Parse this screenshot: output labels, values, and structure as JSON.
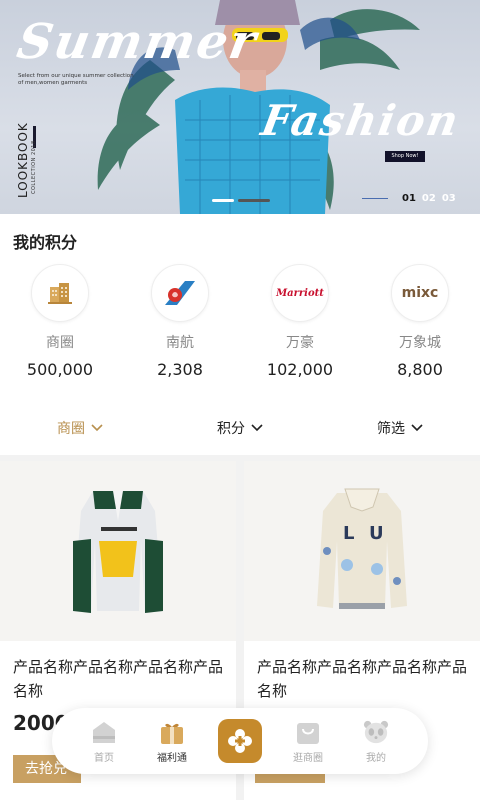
{
  "banner": {
    "title_line1": "Summer",
    "title_line2": "Fashion",
    "tagline": "Select from our unique summer collection of men,women garments",
    "side_title": "LOOKBOOK",
    "side_subtitle": "COLLECTION 2018",
    "shop_button": "Shop Now!",
    "pages": [
      "01",
      "02",
      "03"
    ],
    "active_page": "01"
  },
  "points": {
    "title": "我的积分",
    "items": [
      {
        "name": "商圈",
        "value": "500,000",
        "icon": "building-icon"
      },
      {
        "name": "南航",
        "value": "2,308",
        "icon": "china-southern-logo"
      },
      {
        "name": "万豪",
        "value": "102,000",
        "icon": "marriott-logo",
        "logo_text": "Marriott"
      },
      {
        "name": "万象城",
        "value": "8,800",
        "icon": "the-mixc-logo",
        "logo_text": "mixc"
      }
    ]
  },
  "filters": [
    {
      "label": "商圈",
      "active": true
    },
    {
      "label": "积分",
      "active": false
    },
    {
      "label": "筛选",
      "active": false
    }
  ],
  "products": [
    {
      "name": "产品名称产品名称产品名称产品名称",
      "price": "2000",
      "buy_label": "去抢兑"
    },
    {
      "name": "产品名称产品名称产品名称产品名称",
      "price": "",
      "buy_label": ""
    }
  ],
  "tabbar": {
    "items": [
      {
        "label": "首页",
        "icon": "home-icon"
      },
      {
        "label": "福利通",
        "icon": "gift-icon",
        "active": true
      },
      {
        "label": "",
        "icon": "center-action-icon"
      },
      {
        "label": "逛商圈",
        "icon": "shopping-bag-icon"
      },
      {
        "label": "我的",
        "icon": "panda-icon"
      }
    ]
  },
  "colors": {
    "accent": "#c8a062",
    "center_button": "#c58a2c",
    "active_filter": "#b8904f"
  }
}
